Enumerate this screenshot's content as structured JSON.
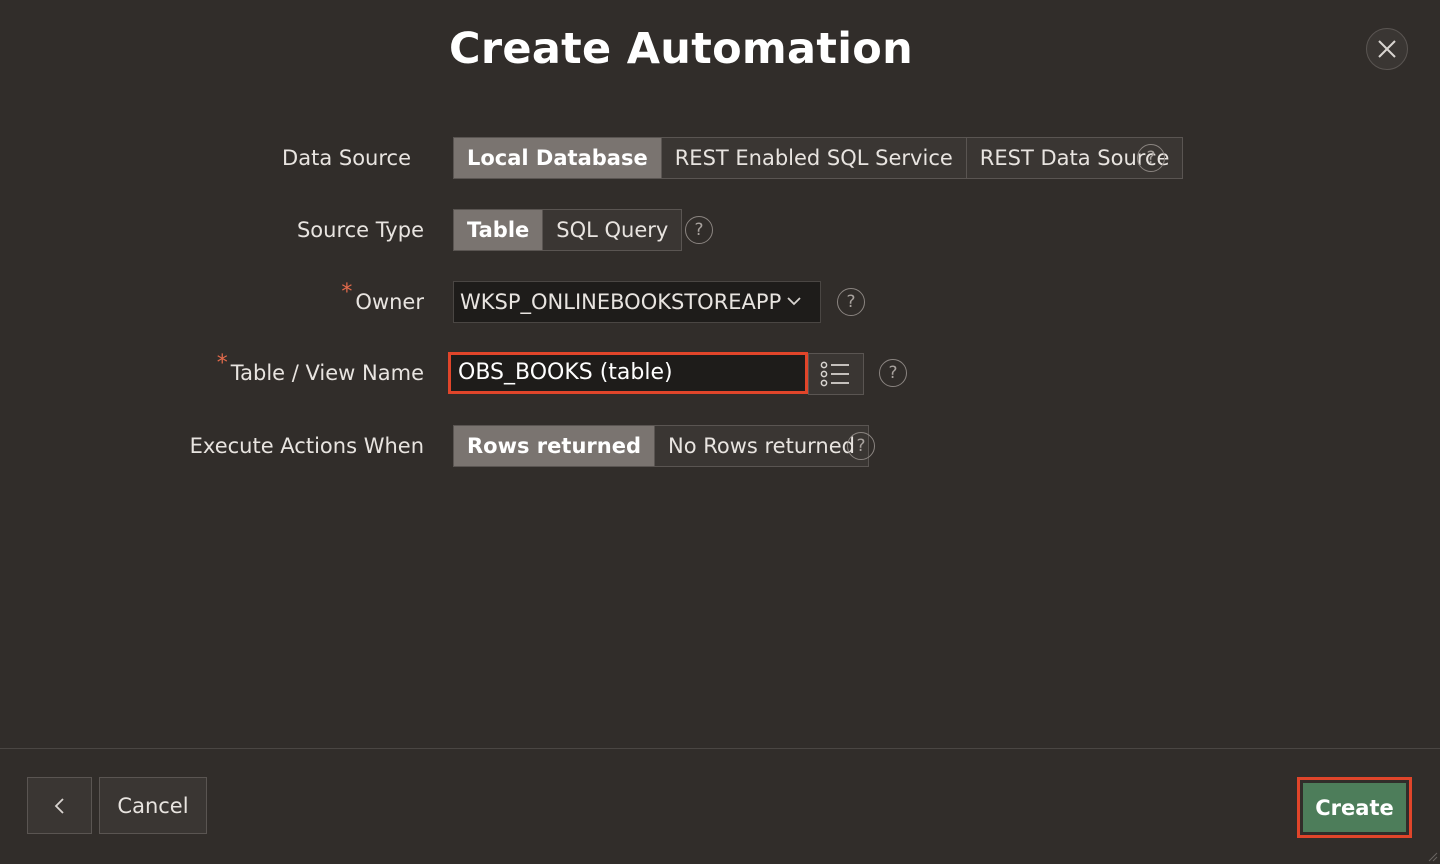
{
  "dialog": {
    "title": "Create Automation",
    "close_icon": "close-icon"
  },
  "form": {
    "data_source": {
      "label": "Data Source",
      "options": [
        "Local Database",
        "REST Enabled SQL Service",
        "REST Data Source"
      ],
      "selected": "Local Database"
    },
    "source_type": {
      "label": "Source Type",
      "options": [
        "Table",
        "SQL Query"
      ],
      "selected": "Table"
    },
    "owner": {
      "required_marker": "*",
      "label": "Owner",
      "value": "WKSP_ONLINEBOOKSTOREAPP"
    },
    "table_view_name": {
      "required_marker": "*",
      "label": "Table / View Name",
      "value": "OBS_BOOKS (table)",
      "lov_icon": "list-icon"
    },
    "execute_actions_when": {
      "label": "Execute Actions When",
      "options": [
        "Rows returned",
        "No Rows returned"
      ],
      "selected": "Rows returned"
    },
    "help_glyph": "?"
  },
  "footer": {
    "back_icon": "chevron-left-icon",
    "cancel_label": "Cancel",
    "create_label": "Create"
  },
  "colors": {
    "background": "#312d2a",
    "active_segment": "#7a7470",
    "create_button": "#4d7d5a",
    "highlight_outline": "#e0452a",
    "required_marker": "#e26a4b"
  }
}
